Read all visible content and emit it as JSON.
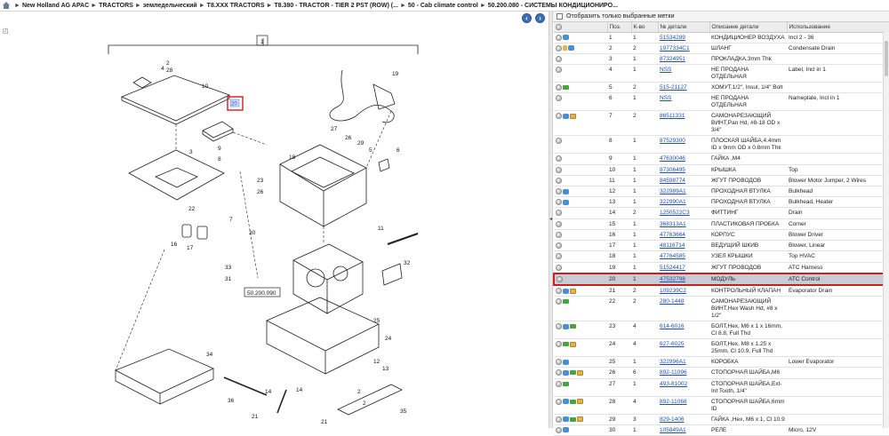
{
  "breadcrumb": {
    "items": [
      "New Holland AG APAC",
      "TRACTORS",
      "земледельческий",
      "T8.XXX TRACTORS",
      "T8.380 - TRACTOR - TIER 2 PST (ROW) (...",
      "50 - Cab climate control",
      "50.200.080 - СИСТЕМЫ КОНДИЦИОНИРО..."
    ]
  },
  "drawing": {
    "page_label": "1",
    "section_label": "50.200.090",
    "highlighted_callout": "20",
    "callouts": [
      "2",
      "3",
      "4",
      "5",
      "6",
      "7",
      "8",
      "9",
      "10",
      "11",
      "12",
      "13",
      "14",
      "15",
      "16",
      "17",
      "18",
      "19",
      "20",
      "21",
      "22",
      "23",
      "24",
      "25",
      "26",
      "27",
      "28",
      "29",
      "30",
      "31",
      "32",
      "33",
      "34",
      "35",
      "36"
    ]
  },
  "filter": {
    "label": "Отобразить только выбранные метки",
    "checked": false
  },
  "table": {
    "columns": [
      "Поз.",
      "К-во",
      "№ детали",
      "Описание детали",
      "Использование"
    ],
    "rows": [
      {
        "icons": [
          "info",
          "swap"
        ],
        "pos": "1",
        "qty": "1",
        "part": "51534289",
        "desc": "КОНДИЦИОНЕР ВОЗДУХА",
        "usage": "Incl 2 - 36"
      },
      {
        "icons": [
          "info",
          "lock",
          "swap"
        ],
        "pos": "2",
        "qty": "2",
        "part": "1977334C1",
        "desc": "ШЛАНГ",
        "usage": "Condensate Drain"
      },
      {
        "icons": [
          "info"
        ],
        "pos": "3",
        "qty": "1",
        "part": "87324951",
        "desc": "ПРОКЛАДКА,3mm Thk",
        "usage": ""
      },
      {
        "icons": [
          "info"
        ],
        "pos": "4",
        "qty": "1",
        "part": "NSS",
        "desc": "НЕ ПРОДАНА ОТДЕЛЬНАЯ",
        "usage": "Label, Incl in 1"
      },
      {
        "icons": [
          "info",
          "go"
        ],
        "pos": "5",
        "qty": "2",
        "part": "515-21127",
        "desc": "ХОМУТ,1/2\", Insul, 1/4\" Bolt",
        "usage": ""
      },
      {
        "icons": [
          "info"
        ],
        "pos": "6",
        "qty": "1",
        "part": "NSS",
        "desc": "НЕ ПРОДАНА ОТДЕЛЬНАЯ",
        "usage": "Nameplate, Incl in 1"
      },
      {
        "icons": [
          "info",
          "swap",
          "box"
        ],
        "pos": "7",
        "qty": "2",
        "part": "86511331",
        "desc": "САМОНАРЕЗАЮЩИЙ ВИНТ,Pan Hd, #8-18 OD x 3/4\"",
        "usage": ""
      },
      {
        "icons": [
          "info"
        ],
        "pos": "8",
        "qty": "1",
        "part": "87529300",
        "desc": "ПЛОСКАЯ ШАЙБА,4.4mm ID x 9mm OD x 0.8mm Thk",
        "usage": ""
      },
      {
        "icons": [
          "info"
        ],
        "pos": "9",
        "qty": "1",
        "part": "47630046",
        "desc": "ГАЙКА ,M4",
        "usage": ""
      },
      {
        "icons": [
          "info"
        ],
        "pos": "10",
        "qty": "1",
        "part": "87306495",
        "desc": "КРЫШКА",
        "usage": "Top"
      },
      {
        "icons": [
          "info"
        ],
        "pos": "11",
        "qty": "1",
        "part": "84598774",
        "desc": "ЖГУТ ПРОВОДОВ",
        "usage": "Blower Motor Jumper, 2 Wires"
      },
      {
        "icons": [
          "info",
          "swap"
        ],
        "pos": "12",
        "qty": "1",
        "part": "322989A1",
        "desc": "ПРОХОДНАЯ ВТУЛКА",
        "usage": "Bulkhead"
      },
      {
        "icons": [
          "info",
          "swap"
        ],
        "pos": "13",
        "qty": "1",
        "part": "322990A1",
        "desc": "ПРОХОДНАЯ ВТУЛКА",
        "usage": "Bulkhead, Heater"
      },
      {
        "icons": [
          "info"
        ],
        "pos": "14",
        "qty": "2",
        "part": "1250522C3",
        "desc": "ФИТТИНГ",
        "usage": "Drain"
      },
      {
        "icons": [
          "info"
        ],
        "pos": "15",
        "qty": "1",
        "part": "368313A1",
        "desc": "ПЛАСТИКОВАЯ ПРОБКА",
        "usage": "Corner"
      },
      {
        "icons": [
          "info"
        ],
        "pos": "16",
        "qty": "1",
        "part": "47763664",
        "desc": "КОРПУС",
        "usage": "Blower Driver"
      },
      {
        "icons": [
          "info"
        ],
        "pos": "17",
        "qty": "1",
        "part": "48116714",
        "desc": "ВЕДУЩИЙ ШКИВ",
        "usage": "Blower, Linear"
      },
      {
        "icons": [
          "info"
        ],
        "pos": "18",
        "qty": "1",
        "part": "47764585",
        "desc": "УЗЕЛ КРЫШКИ",
        "usage": "Top HVAC"
      },
      {
        "icons": [
          "info"
        ],
        "pos": "19",
        "qty": "1",
        "part": "51524417",
        "desc": "ЖГУТ ПРОВОДОВ",
        "usage": "ATC Harness"
      },
      {
        "icons": [
          "info"
        ],
        "pos": "20",
        "qty": "1",
        "part": "47532798",
        "desc": "МОДУЛЬ",
        "usage": "ATC Control",
        "selected": true
      },
      {
        "icons": [
          "info",
          "swap",
          "box"
        ],
        "pos": "21",
        "qty": "2",
        "part": "109239C2",
        "desc": "КОНТРОЛЬНЫЙ КЛАПАН",
        "usage": "Evaporator Drain"
      },
      {
        "icons": [
          "info",
          "go"
        ],
        "pos": "22",
        "qty": "2",
        "part": "280-1448",
        "desc": "САМОНАРЕЗАЮЩИЙ ВИНТ,Hex Wash Hd, #8 x 1/2\"",
        "usage": ""
      },
      {
        "icons": [
          "info",
          "swap",
          "go"
        ],
        "pos": "23",
        "qty": "4",
        "part": "614-6016",
        "desc": "БОЛТ,Hex, M6 x 1 x 16mm, Cl 8.8, Full Thd",
        "usage": ""
      },
      {
        "icons": [
          "info",
          "go",
          "box"
        ],
        "pos": "24",
        "qty": "4",
        "part": "627-6025",
        "desc": "БОЛТ,Hex, M8 x 1.25 x 25mm, Cl 10.9, Full Thd",
        "usage": ""
      },
      {
        "icons": [
          "info",
          "swap"
        ],
        "pos": "25",
        "qty": "1",
        "part": "322996A1",
        "desc": "КОРОБКА",
        "usage": "Lower Evaporator"
      },
      {
        "icons": [
          "info",
          "swap",
          "go",
          "box"
        ],
        "pos": "26",
        "qty": "6",
        "part": "892-11096",
        "desc": "СТОПОРНАЯ ШАЙБА,M6",
        "usage": ""
      },
      {
        "icons": [
          "info",
          "go"
        ],
        "pos": "27",
        "qty": "1",
        "part": "493-81002",
        "desc": "СТОПОРНАЯ ШАЙБА,Ext-Int Tooth, 1/4\"",
        "usage": ""
      },
      {
        "icons": [
          "info",
          "swap",
          "go",
          "box"
        ],
        "pos": "28",
        "qty": "4",
        "part": "892-11068",
        "desc": "СТОПОРНАЯ ШАЙБА,6mm ID",
        "usage": ""
      },
      {
        "icons": [
          "info",
          "swap",
          "go",
          "box"
        ],
        "pos": "29",
        "qty": "3",
        "part": "829-1406",
        "desc": "ГАЙКА ,Hex, M6 x 1, Cl 10.9",
        "usage": ""
      },
      {
        "icons": [
          "info",
          "swap"
        ],
        "pos": "30",
        "qty": "1",
        "part": "105849A1",
        "desc": "РЕЛЕ",
        "usage": "Micro, 12V"
      }
    ]
  },
  "colors": {
    "selection_border": "#d21b1b",
    "selection_fill": "#c8ccd4",
    "link": "#1f4fb0",
    "nav_button": "#3d6fb5"
  }
}
